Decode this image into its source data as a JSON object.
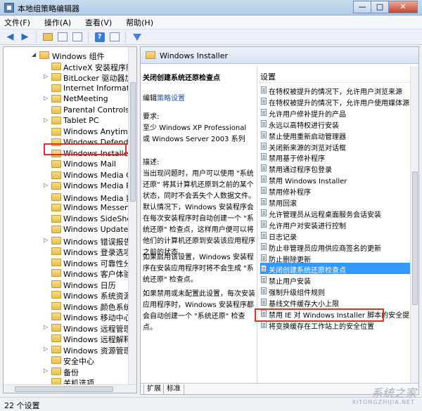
{
  "window": {
    "title": "本地组策略编辑器",
    "controls": [
      "—",
      "□",
      "✕"
    ]
  },
  "menubar": [
    "文件(F)",
    "操作(A)",
    "查看(V)",
    "帮助(H)"
  ],
  "toolbar": {
    "icons": [
      "back-arrow-icon",
      "forward-arrow-icon",
      "folder-up-icon",
      "show-hide-tree-icon",
      "export-list-icon",
      "help-icon",
      "properties-icon",
      "filter-icon"
    ]
  },
  "tree": {
    "parent": "Windows 组件",
    "items": [
      {
        "label": "ActiveX 安装程序服务",
        "arrow": ""
      },
      {
        "label": "BitLocker 驱动器加密",
        "arrow": "▷"
      },
      {
        "label": "Internet Information",
        "arrow": ""
      },
      {
        "label": "NetMeeting",
        "arrow": "▷"
      },
      {
        "label": "Parental Controls",
        "arrow": ""
      },
      {
        "label": "Tablet PC",
        "arrow": "▷"
      },
      {
        "label": "Windows Anytime Up",
        "arrow": ""
      },
      {
        "label": "Windows Defender",
        "arrow": ""
      },
      {
        "label": "Windows Installer",
        "arrow": ""
      },
      {
        "label": "Windows Mail",
        "arrow": ""
      },
      {
        "label": "Windows Media Cent",
        "arrow": ""
      },
      {
        "label": "Windows Media Playe",
        "arrow": "▷"
      },
      {
        "label": "Windows Media 数字",
        "arrow": ""
      },
      {
        "label": "Windows Messenger",
        "arrow": ""
      },
      {
        "label": "Windows SideShow",
        "arrow": ""
      },
      {
        "label": "Windows Update",
        "arrow": ""
      },
      {
        "label": "Windows 错误报告",
        "arrow": "▷"
      },
      {
        "label": "Windows 登录选项",
        "arrow": ""
      },
      {
        "label": "Windows 可靠性分析",
        "arrow": ""
      },
      {
        "label": "Windows 客户体验改",
        "arrow": ""
      },
      {
        "label": "Windows 日历",
        "arrow": ""
      },
      {
        "label": "Windows 系统资源管",
        "arrow": ""
      },
      {
        "label": "Windows 颜色系统",
        "arrow": ""
      },
      {
        "label": "Windows 移动中心",
        "arrow": ""
      },
      {
        "label": "Windows 远程管理 (V",
        "arrow": "▷"
      },
      {
        "label": "Windows 远程解释器",
        "arrow": ""
      },
      {
        "label": "Windows 资源管理器",
        "arrow": "▷"
      },
      {
        "label": "安全中心",
        "arrow": ""
      },
      {
        "label": "备份",
        "arrow": "▷"
      },
      {
        "label": "关机选项",
        "arrow": ""
      }
    ]
  },
  "right_header": {
    "title": "Windows Installer"
  },
  "description": {
    "title": "关闭创建系统还原检查点",
    "edit_prefix": "编辑",
    "edit_link": "策略设置",
    "requirements_label": "要求:",
    "requirements_text": "至少 Windows XP Professional 或 Windows Server 2003 系列",
    "desc_label": "描述:",
    "desc_text": "当出现问题时，用户可以使用 \"系统还原\" 将其计算机还原到之前的某个状态，同时不会丢失个人数据文件。默认情况下，Windows 安装程序会在每次安装程序时自动创建一个 \"系统还原\" 检查点，这样用户便可以将他们的计算机还原到安装该应用程序之前的状态。",
    "enabled_text": "如果启用该设置，Windows 安装程序在安装应用程序时将不会生成 \"系统还原\" 检查点。",
    "disabled_text": "如果禁用或未配置此设置，每次安装应用程序时，Windows 安装程序都会自动创建一个 \"系统还原\" 检查点。"
  },
  "settings": {
    "header": "设置",
    "items": [
      "在特权被提升的情况下，允许用户浏览来源",
      "在特权被提升的情况下，允许用户使用媒体源",
      "允许用户修补提升的产品",
      "永远以高特权进行安装",
      "禁止使用重新启动管理器",
      "关闭新来源的浏览对话框",
      "禁用基于修补程序",
      "禁用通过程序包登录",
      "禁用 Windows Installer",
      "禁用修补程序",
      "禁用回滚",
      "允许管理员从远程桌面服务会话安装",
      "允许用户对安装进行控制",
      "日志记录",
      "防止非管理员应用供应商签名的更新",
      "防止删除更新",
      "关闭创建系统还原检查点",
      "禁止用户安装",
      "强制升级组件规则",
      "基线文件缓存大小上限",
      "禁用 IE 对 Windows Installer 脚本的安全提示",
      "将变换缓存在工作站上的安全位置"
    ],
    "selected_index": 16
  },
  "tabs": [
    "扩展",
    "标准"
  ],
  "statusbar": {
    "text": "22 个设置"
  },
  "watermark": {
    "main": "系统之家",
    "sub": "XITONGZHIJIA.NET"
  }
}
